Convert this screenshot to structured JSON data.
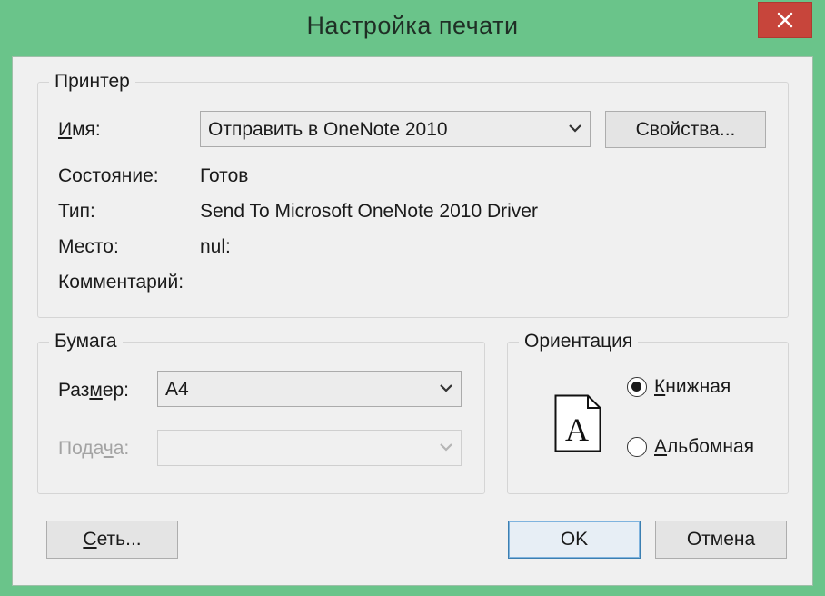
{
  "window": {
    "title": "Настройка печати",
    "close_glyph": "✕"
  },
  "printer": {
    "group_label": "Принтер",
    "name_label": "Имя:",
    "name_value": "Отправить в OneNote 2010",
    "properties_button": "Свойства...",
    "status_label": "Состояние:",
    "status_value": "Готов",
    "type_label": "Тип:",
    "type_value": "Send To Microsoft OneNote 2010 Driver",
    "where_label": "Место:",
    "where_value": "nul:",
    "comment_label": "Комментарий:",
    "comment_value": ""
  },
  "paper": {
    "group_label": "Бумага",
    "size_label": "Размер:",
    "size_value": "A4",
    "source_label": "Подача:",
    "source_value": ""
  },
  "orientation": {
    "group_label": "Ориентация",
    "preview_letter": "A",
    "options": [
      {
        "label": "Книжная",
        "selected": true
      },
      {
        "label": "Альбомная",
        "selected": false
      }
    ]
  },
  "buttons": {
    "network": "Сеть...",
    "ok": "OK",
    "cancel": "Отмена"
  },
  "icons": {
    "close": "close-icon",
    "dropdown": "chevron-down-icon",
    "page": "page-portrait-icon"
  },
  "colors": {
    "window_frame": "#6ac48a",
    "close_button": "#c7453b",
    "dialog_background": "#f0f0f0"
  }
}
